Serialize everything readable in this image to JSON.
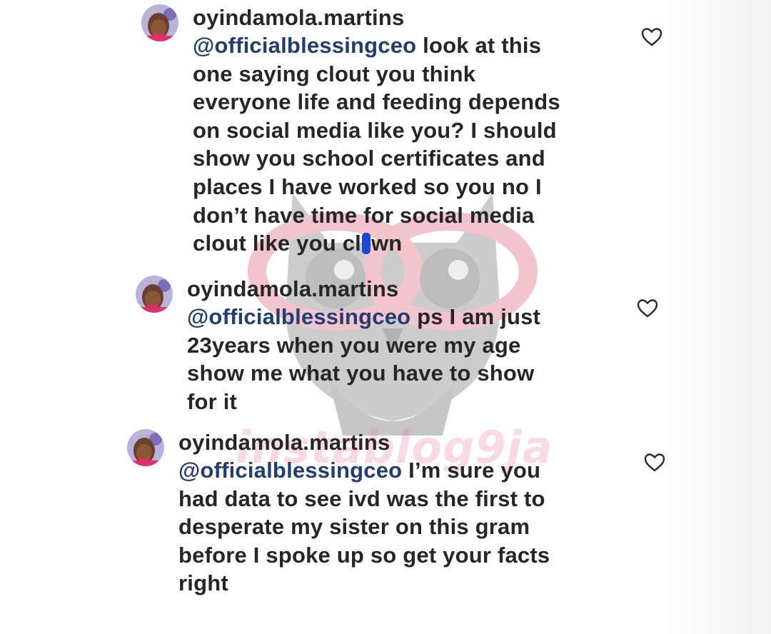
{
  "comments": [
    {
      "username": "oyindamola.martins",
      "mention": "@officialblessingceo",
      "lines": [
        " look at this",
        "one saying clout you think",
        "everyone life and feeding depends",
        "on social media like you? I should",
        "show you school certificates and",
        "places I have worked so you no I",
        "don’t have time for social media"
      ],
      "last_line_start": "clout like you cl",
      "last_line_end": "wn"
    },
    {
      "username": "oyindamola.martins",
      "mention": "@officialblessingceo",
      "lines": [
        " ps I am just",
        "23years when you were my age",
        "show me what you have to show",
        "for it"
      ]
    },
    {
      "username": "oyindamola.martins",
      "mention": "@officialblessingceo",
      "lines": [
        " I’m sure you",
        "had data to see ivd was the first to",
        "desperate my sister on this gram",
        "before I spoke up so get your facts",
        "right"
      ]
    }
  ],
  "icons": {
    "like": "heart-outline-icon",
    "avatar": "profile-avatar"
  },
  "watermark": {
    "text": "instablog9ja"
  },
  "colors": {
    "text": "#262626",
    "mention": "#233d6e",
    "scribble": "#1c48d6"
  }
}
